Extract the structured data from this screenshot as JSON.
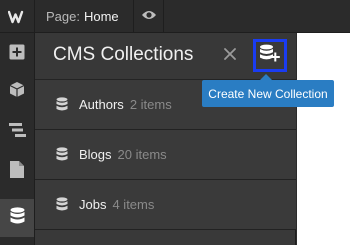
{
  "topbar": {
    "logo_icon": "webflow-logo-icon",
    "page_prefix": "Page:",
    "page_name": "Home",
    "preview_icon": "eye-icon"
  },
  "rail": {
    "items": [
      {
        "icon": "add-plus-icon"
      },
      {
        "icon": "box-3d-icon"
      },
      {
        "icon": "navigator-lines-icon"
      },
      {
        "icon": "page-document-icon"
      },
      {
        "icon": "database-cms-icon",
        "active": true
      }
    ]
  },
  "panel": {
    "title": "CMS Collections",
    "close_icon": "close-icon",
    "add_icon": "database-add-icon",
    "collections": [
      {
        "name": "Authors",
        "count": "2 items"
      },
      {
        "name": "Blogs",
        "count": "20 items"
      },
      {
        "name": "Jobs",
        "count": "4 items"
      }
    ]
  },
  "tooltip": {
    "text": "Create New Collection"
  },
  "colors": {
    "accent_outline": "#1a3cf2",
    "tooltip_bg": "#2a7dc3",
    "panel_bg": "#393939",
    "rail_bg": "#2b2b2b"
  }
}
